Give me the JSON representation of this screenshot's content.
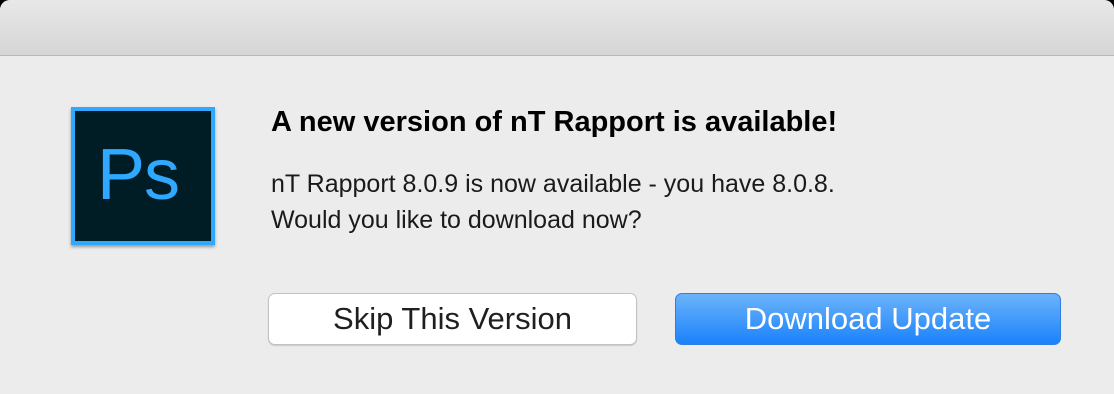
{
  "dialog": {
    "icon": {
      "name": "photoshop-app-icon",
      "label": "Ps",
      "border_color": "#31a8ff",
      "background_color": "#001d26"
    },
    "headline": "A new version of nT Rapport is available!",
    "message_line1": "nT Rapport 8.0.9 is now available - you have 8.0.8.",
    "message_line2": "Would you like to download now?",
    "buttons": {
      "skip_label": "Skip This Version",
      "download_label": "Download Update"
    },
    "colors": {
      "accent": "#1a82fb",
      "background": "#ececec"
    }
  }
}
